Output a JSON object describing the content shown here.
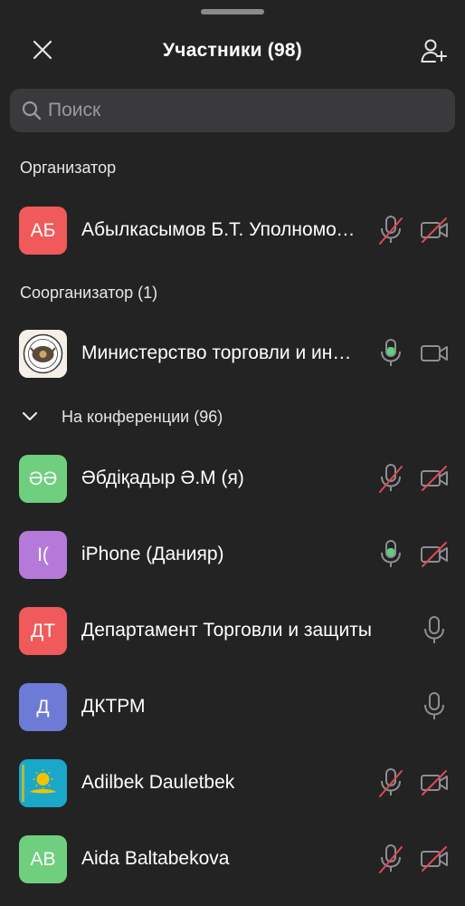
{
  "header": {
    "title": "Участники (98)"
  },
  "search": {
    "placeholder": "Поиск"
  },
  "sections": {
    "host": "Организатор",
    "cohost": "Соорганизатор (1)",
    "in_meeting": "На конференции (96)"
  },
  "participants": [
    {
      "initials": "АБ",
      "name": "Абылкасымов Б.Т. Уполномоченный",
      "avatar_color": "#f05a5a",
      "mic": "muted",
      "camera": "off"
    },
    {
      "initials": "",
      "name": "Министерство торговли и интеграции",
      "avatar_color": "#e8e2d6",
      "avatar_icon": "ministry-emblem-icon",
      "mic": "on",
      "camera": "on"
    },
    {
      "initials": "ӘӘ",
      "name": "Әбдіқадыр Ә.М (я)",
      "avatar_color": "#6fcf7f",
      "mic": "muted",
      "camera": "off"
    },
    {
      "initials": "I(",
      "name": "iPhone (Данияр)",
      "avatar_color": "#b57ad9",
      "mic": "on",
      "camera": "off"
    },
    {
      "initials": "ДТ",
      "name": "Департамент Торговли и защиты",
      "avatar_color": "#f05a5a",
      "mic": "idle",
      "camera": "none"
    },
    {
      "initials": "Д",
      "name": "ДКТРМ",
      "avatar_color": "#6e7bd6",
      "mic": "idle",
      "camera": "none"
    },
    {
      "initials": "",
      "name": "Adilbek Dauletbek",
      "avatar_color": "#1aa7c9",
      "avatar_icon": "kazakhstan-flag-icon",
      "mic": "muted",
      "camera": "off"
    },
    {
      "initials": "AB",
      "name": "Aida Baltabekova",
      "avatar_color": "#6fcf7f",
      "mic": "muted",
      "camera": "off"
    }
  ],
  "colors": {
    "background": "#232323",
    "muted_red": "#e0485a",
    "mic_on_green": "#5fcf7f",
    "icon_gray": "#9a9a9e"
  }
}
